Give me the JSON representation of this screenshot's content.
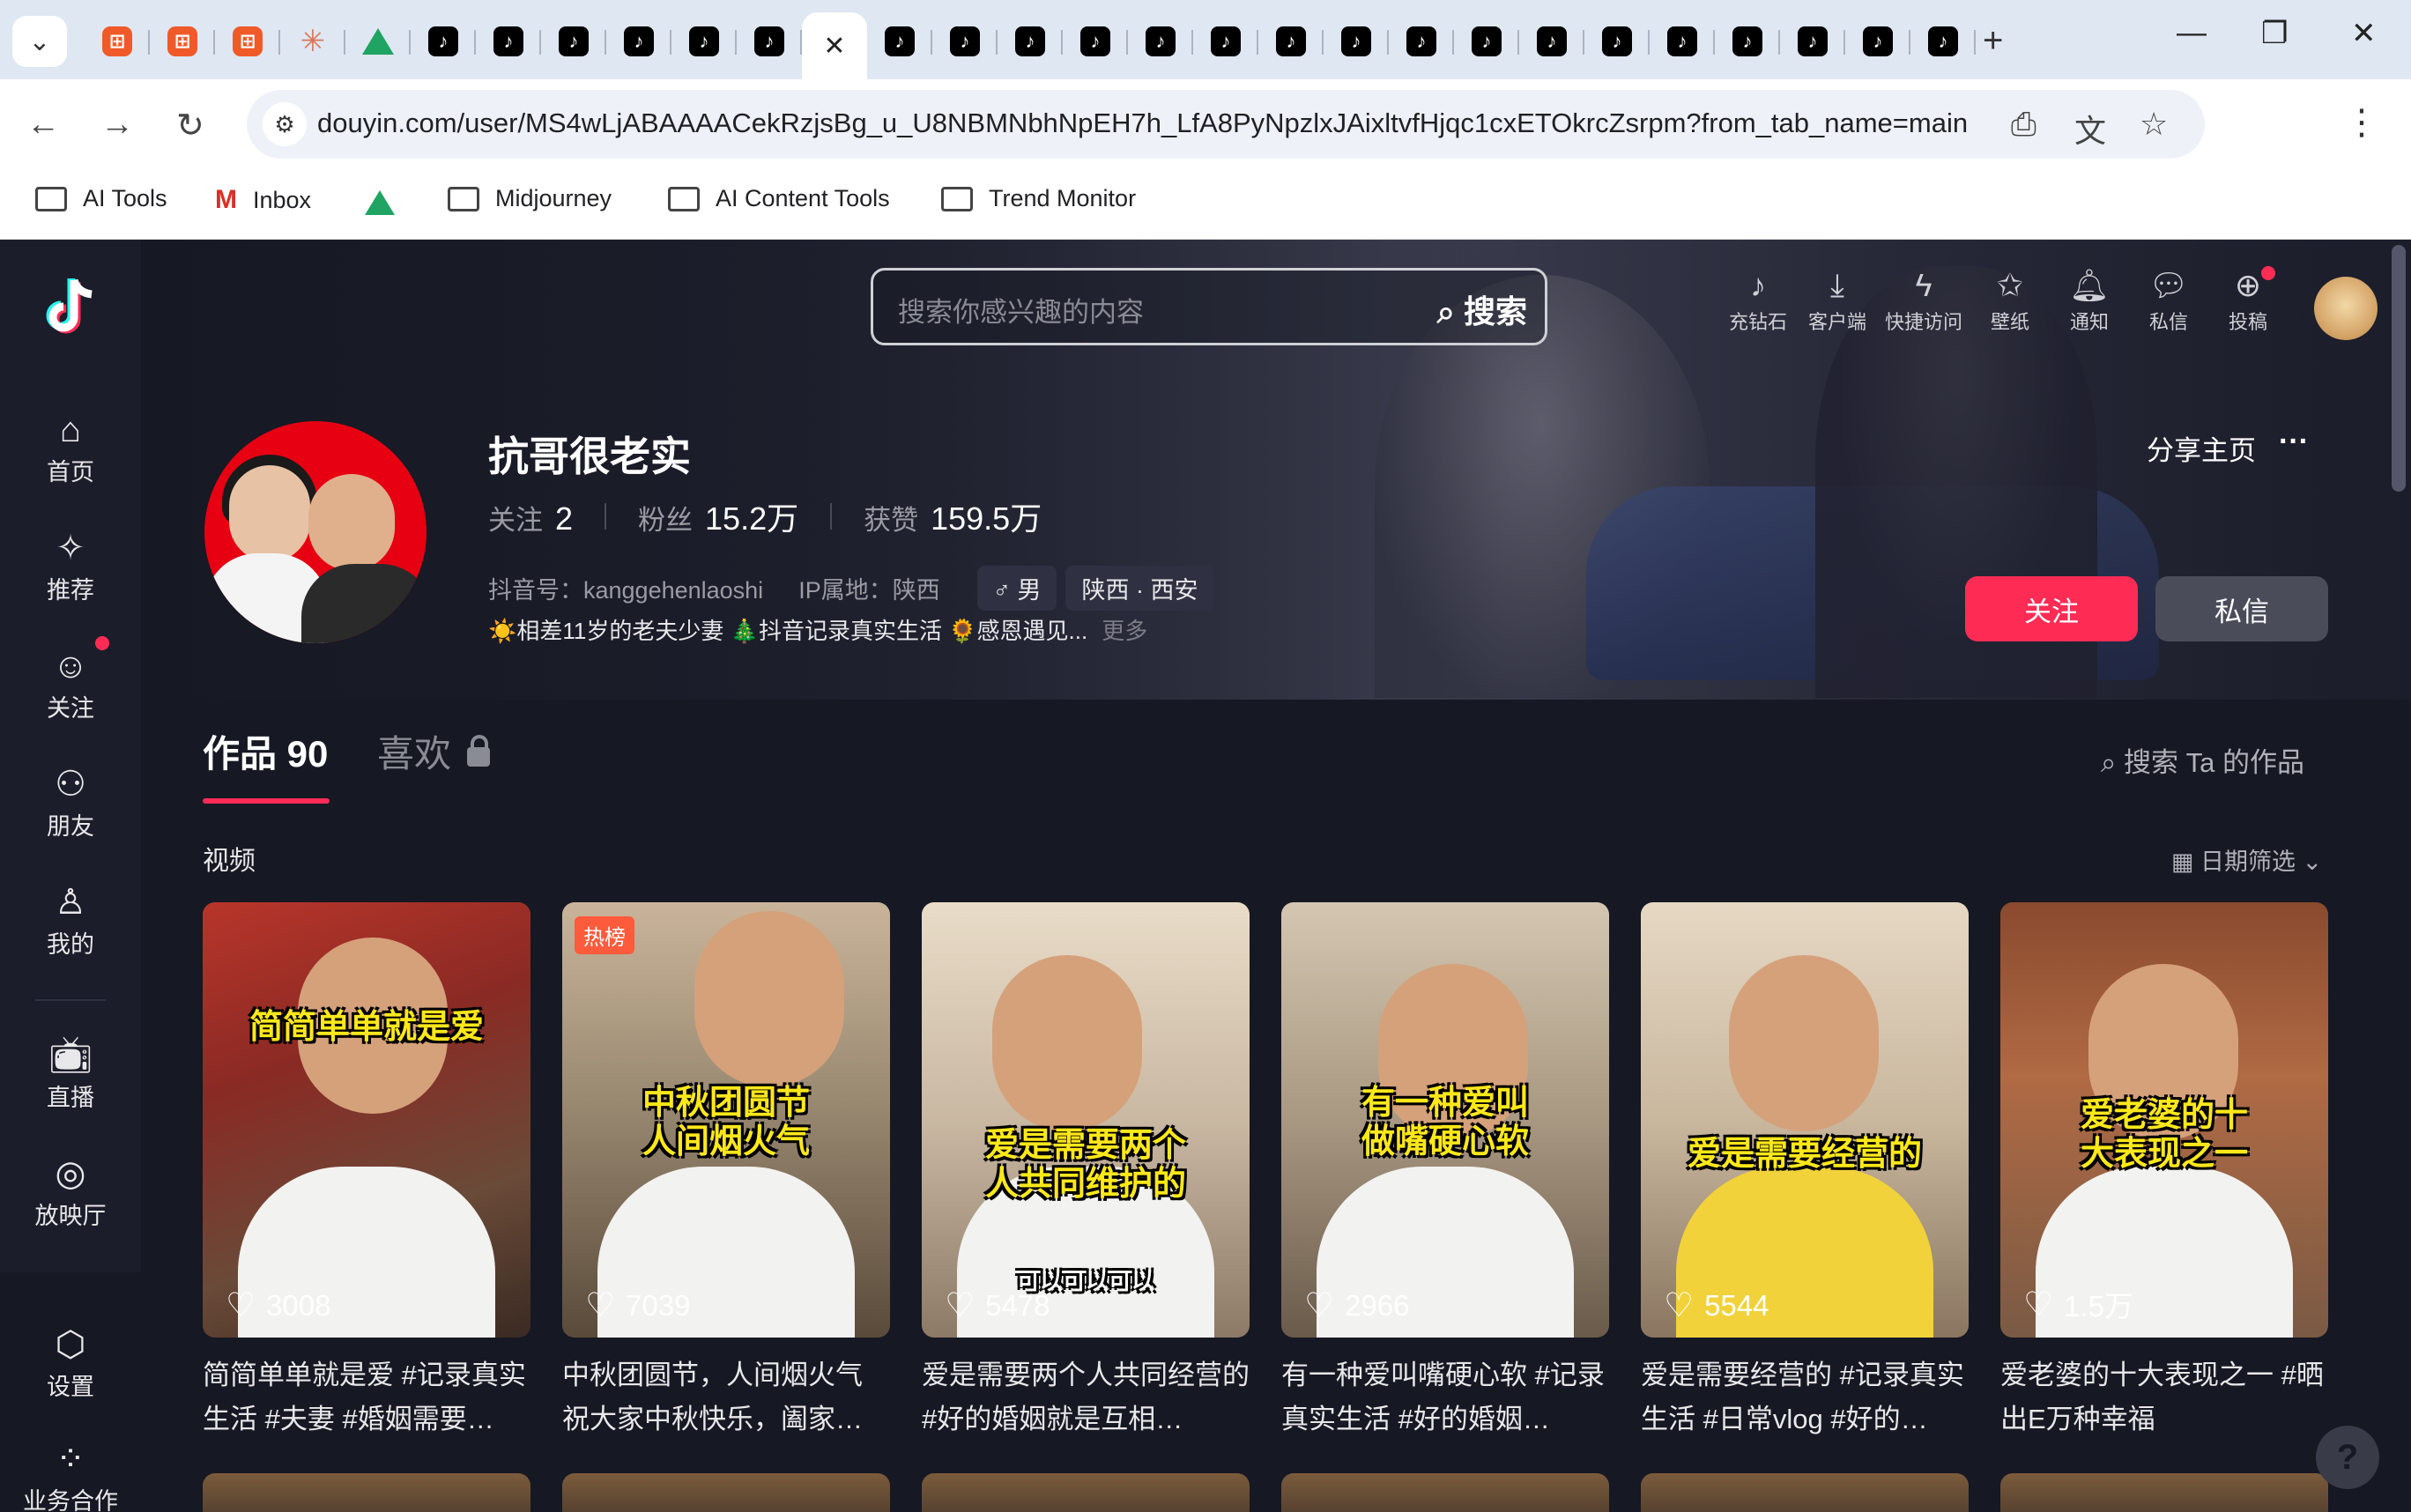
{
  "browser": {
    "tabs": [
      {
        "icon": "red-app-icon"
      },
      {
        "icon": "red-app-icon"
      },
      {
        "icon": "red-app-icon"
      },
      {
        "icon": "claude-star-icon"
      },
      {
        "icon": "google-drive-icon"
      },
      {
        "icon": "tiktok-icon"
      },
      {
        "icon": "tiktok-icon"
      },
      {
        "icon": "tiktok-icon"
      },
      {
        "icon": "tiktok-icon"
      },
      {
        "icon": "tiktok-icon"
      },
      {
        "icon": "tiktok-icon"
      },
      {
        "icon": "close-icon",
        "active": true
      },
      {
        "icon": "tiktok-icon"
      },
      {
        "icon": "tiktok-icon"
      },
      {
        "icon": "tiktok-icon"
      },
      {
        "icon": "tiktok-icon"
      },
      {
        "icon": "tiktok-icon"
      },
      {
        "icon": "tiktok-icon"
      },
      {
        "icon": "tiktok-icon"
      },
      {
        "icon": "tiktok-icon"
      },
      {
        "icon": "tiktok-icon"
      },
      {
        "icon": "tiktok-icon"
      },
      {
        "icon": "tiktok-icon"
      },
      {
        "icon": "tiktok-icon"
      },
      {
        "icon": "tiktok-icon"
      },
      {
        "icon": "tiktok-icon"
      },
      {
        "icon": "tiktok-icon"
      },
      {
        "icon": "tiktok-icon"
      },
      {
        "icon": "tiktok-icon"
      }
    ],
    "new_tab": "+",
    "url": "douyin.com/user/MS4wLjABAAAACekRzjsBg_u_U8NBMNbhNpEH7h_LfA8PyNpzlxJAixltvfHjqc1cxETOkrcZsrpm?from_tab_name=main",
    "bookmarks": [
      {
        "label": "AI Tools",
        "icon": "folder-icon"
      },
      {
        "label": "Inbox",
        "icon": "gmail-icon"
      },
      {
        "label": "",
        "icon": "google-drive-icon"
      },
      {
        "label": "Midjourney",
        "icon": "folder-icon"
      },
      {
        "label": "AI Content Tools",
        "icon": "folder-icon"
      },
      {
        "label": "Trend Monitor",
        "icon": "folder-icon"
      }
    ]
  },
  "sidebar": {
    "items": [
      {
        "label": "首页",
        "icon": "home-icon"
      },
      {
        "label": "推荐",
        "icon": "sparkle-icon"
      },
      {
        "label": "关注",
        "icon": "follow-icon"
      },
      {
        "label": "朋友",
        "icon": "friends-icon"
      },
      {
        "label": "我的",
        "icon": "user-icon"
      },
      {
        "label": "直播",
        "icon": "live-tv-icon"
      },
      {
        "label": "放映厅",
        "icon": "cinema-icon"
      },
      {
        "label": "设置",
        "icon": "settings-icon"
      },
      {
        "label": "业务合作",
        "icon": "business-grid-icon"
      }
    ]
  },
  "header": {
    "search_placeholder": "搜索你感兴趣的内容",
    "search_button": "搜索",
    "icons": [
      {
        "label": "充钻石",
        "icon": "diamond-icon"
      },
      {
        "label": "客户端",
        "icon": "download-icon"
      },
      {
        "label": "快捷访问",
        "icon": "lightning-icon"
      },
      {
        "label": "壁纸",
        "icon": "wallpaper-icon"
      },
      {
        "label": "通知",
        "icon": "bell-icon"
      },
      {
        "label": "私信",
        "icon": "chat-icon"
      },
      {
        "label": "投稿",
        "icon": "upload-icon"
      }
    ]
  },
  "profile": {
    "name": "抗哥很老实",
    "following_label": "关注",
    "following_count": "2",
    "fans_label": "粉丝",
    "fans_count": "15.2万",
    "likes_label": "获赞",
    "likes_count": "159.5万",
    "douyin_id": "抖音号：kanggehenlaoshi",
    "ip_location": "IP属地：陕西",
    "gender": "♂ 男",
    "region": "陕西 · 西安",
    "bio": "☀️相差11岁的老夫少妻 🎄抖音记录真实生活 🌻感恩遇见...",
    "bio_more": "更多",
    "share_label": "分享主页",
    "more_label": "···",
    "follow_button": "关注",
    "message_button": "私信"
  },
  "content": {
    "tab_works": "作品 90",
    "tab_likes": "喜欢",
    "search_works": "搜索 Ta 的作品",
    "section_title": "视频",
    "date_filter": "日期筛选",
    "videos": [
      {
        "caption": "简简单单就是爱",
        "likes": "3008",
        "desc": "简简单单就是爱 #记录真实生活 #夫妻 #婚姻需要…",
        "hot": ""
      },
      {
        "caption": "中秋团圆节\n人间烟火气",
        "likes": "7039",
        "desc": "中秋团圆节，人间烟火气 祝大家中秋快乐，阖家…",
        "hot": "热榜"
      },
      {
        "caption": "爱是需要两个\n人共同维护的",
        "likes": "5478",
        "desc": "爱是需要两个人共同经营的 #好的婚姻就是互相…",
        "hot": ""
      },
      {
        "caption": "有一种爱叫\n做嘴硬心软",
        "likes": "2966",
        "desc": "有一种爱叫嘴硬心软 #记录真实生活 #好的婚姻…",
        "hot": ""
      },
      {
        "caption": "爱是需要经营的",
        "likes": "5544",
        "desc": "爱是需要经营的 #记录真实生活 #日常vlog #好的…",
        "hot": ""
      },
      {
        "caption": "爱老婆的十\n大表现之一",
        "likes": "1.5万",
        "desc": "爱老婆的十大表现之一 #晒出E万种幸福",
        "hot": ""
      }
    ],
    "video3_subcaption": "可以可以可以"
  },
  "colors": {
    "accent": "#fe2c55",
    "background": "#161823",
    "caption_yellow": "#ffe81a"
  }
}
